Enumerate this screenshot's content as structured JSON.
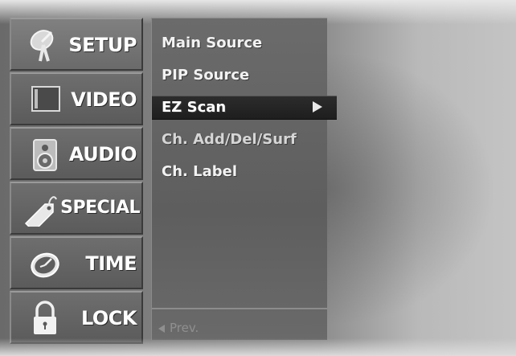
{
  "menu": {
    "categories": [
      {
        "label": "SETUP",
        "icon": "satellite-dish-icon",
        "selected": true
      },
      {
        "label": "VIDEO",
        "icon": "screen-icon",
        "selected": false
      },
      {
        "label": "AUDIO",
        "icon": "speaker-icon",
        "selected": false
      },
      {
        "label": "SPECIAL",
        "icon": "tag-icon",
        "selected": false
      },
      {
        "label": "TIME",
        "icon": "clock-icon",
        "selected": false
      },
      {
        "label": "LOCK",
        "icon": "padlock-icon",
        "selected": false
      }
    ],
    "submenu": {
      "items": [
        {
          "label": "Main Source"
        },
        {
          "label": "PIP Source"
        },
        {
          "label": "EZ Scan",
          "selected": true,
          "has_arrow": true
        },
        {
          "label": "Ch. Add/Del/Surf"
        },
        {
          "label": "Ch. Label"
        }
      ],
      "prev_label": "Prev."
    }
  }
}
